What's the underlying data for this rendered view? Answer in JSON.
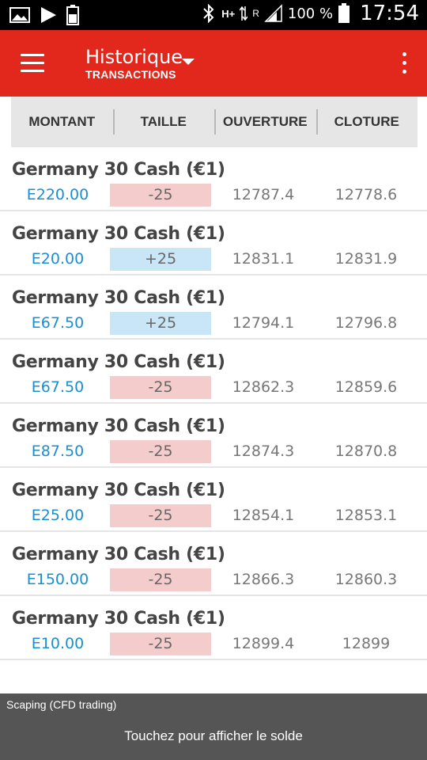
{
  "statusbar": {
    "battery_pct": "100 %",
    "time": "17:54",
    "network": "H+",
    "roaming": "R",
    "icons": [
      "image-icon",
      "play-store-icon",
      "battery-status-icon",
      "bluetooth-icon",
      "data-arrows-icon",
      "signal-icon",
      "battery-icon"
    ]
  },
  "appbar": {
    "title": "Historique",
    "subtitle": "TRANSACTIONS",
    "background": "#e2281d"
  },
  "columns": {
    "amount": "MONTANT",
    "size": "TAILLE",
    "open": "OUVERTURE",
    "close": "CLOTURE"
  },
  "rows": [
    {
      "name": "Germany 30 Cash (€1)",
      "amount": "E220.00",
      "size": "-25",
      "open": "12787.4",
      "close": "12778.6"
    },
    {
      "name": "Germany 30 Cash (€1)",
      "amount": "E20.00",
      "size": "+25",
      "open": "12831.1",
      "close": "12831.9"
    },
    {
      "name": "Germany 30 Cash (€1)",
      "amount": "E67.50",
      "size": "+25",
      "open": "12794.1",
      "close": "12796.8"
    },
    {
      "name": "Germany 30 Cash (€1)",
      "amount": "E67.50",
      "size": "-25",
      "open": "12862.3",
      "close": "12859.6"
    },
    {
      "name": "Germany 30 Cash (€1)",
      "amount": "E87.50",
      "size": "-25",
      "open": "12874.3",
      "close": "12870.8"
    },
    {
      "name": "Germany 30 Cash (€1)",
      "amount": "E25.00",
      "size": "-25",
      "open": "12854.1",
      "close": "12853.1"
    },
    {
      "name": "Germany 30 Cash (€1)",
      "amount": "E150.00",
      "size": "-25",
      "open": "12866.3",
      "close": "12860.3"
    },
    {
      "name": "Germany 30 Cash (€1)",
      "amount": "E10.00",
      "size": "-25",
      "open": "12899.4",
      "close": "12899"
    }
  ],
  "colors": {
    "negative_size_bg": "#f5cccc",
    "positive_size_bg": "#c8e6f5",
    "amount_text": "#1a8fd0"
  },
  "footer": {
    "account": "Scaping (CFD trading)",
    "balance_prompt": "Touchez pour afficher le solde"
  }
}
